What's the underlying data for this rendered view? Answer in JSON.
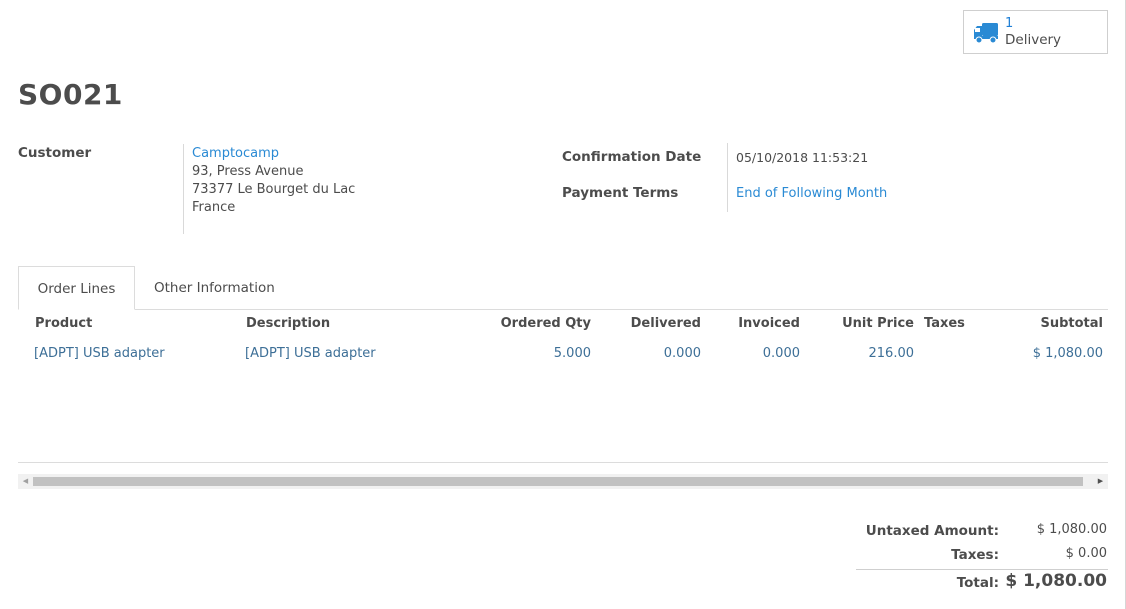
{
  "delivery_button": {
    "count": "1",
    "label": "Delivery"
  },
  "order": {
    "name": "SO021"
  },
  "customer": {
    "label": "Customer",
    "name": "Camptocamp",
    "address_line1": "93, Press Avenue",
    "address_line2": "73377 Le Bourget du Lac",
    "country": "France"
  },
  "confirmation": {
    "label": "Confirmation Date",
    "value": "05/10/2018 11:53:21"
  },
  "payment_terms": {
    "label": "Payment Terms",
    "value": "End of Following Month"
  },
  "tabs": [
    {
      "label": "Order Lines",
      "active": true
    },
    {
      "label": "Other Information",
      "active": false
    }
  ],
  "order_lines": {
    "columns": [
      "Product",
      "Description",
      "Ordered Qty",
      "Delivered",
      "Invoiced",
      "Unit Price",
      "Taxes",
      "Subtotal"
    ],
    "rows": [
      {
        "product": "[ADPT] USB adapter",
        "description": "[ADPT] USB adapter",
        "ordered_qty": "5.000",
        "delivered": "0.000",
        "invoiced": "0.000",
        "unit_price": "216.00",
        "taxes": "",
        "subtotal": "$ 1,080.00"
      }
    ]
  },
  "totals": {
    "untaxed_label": "Untaxed Amount:",
    "untaxed_value": "$ 1,080.00",
    "taxes_label": "Taxes:",
    "taxes_value": "$ 0.00",
    "total_label": "Total:",
    "total_value": "$ 1,080.00"
  },
  "colors": {
    "link": "#2a8ad4",
    "teal_link": "#3d6f97",
    "text": "#4c4c4c"
  },
  "icons": {
    "delivery": "truck-icon",
    "scroll_left": "arrow-left-icon",
    "scroll_right": "arrow-right-icon"
  }
}
